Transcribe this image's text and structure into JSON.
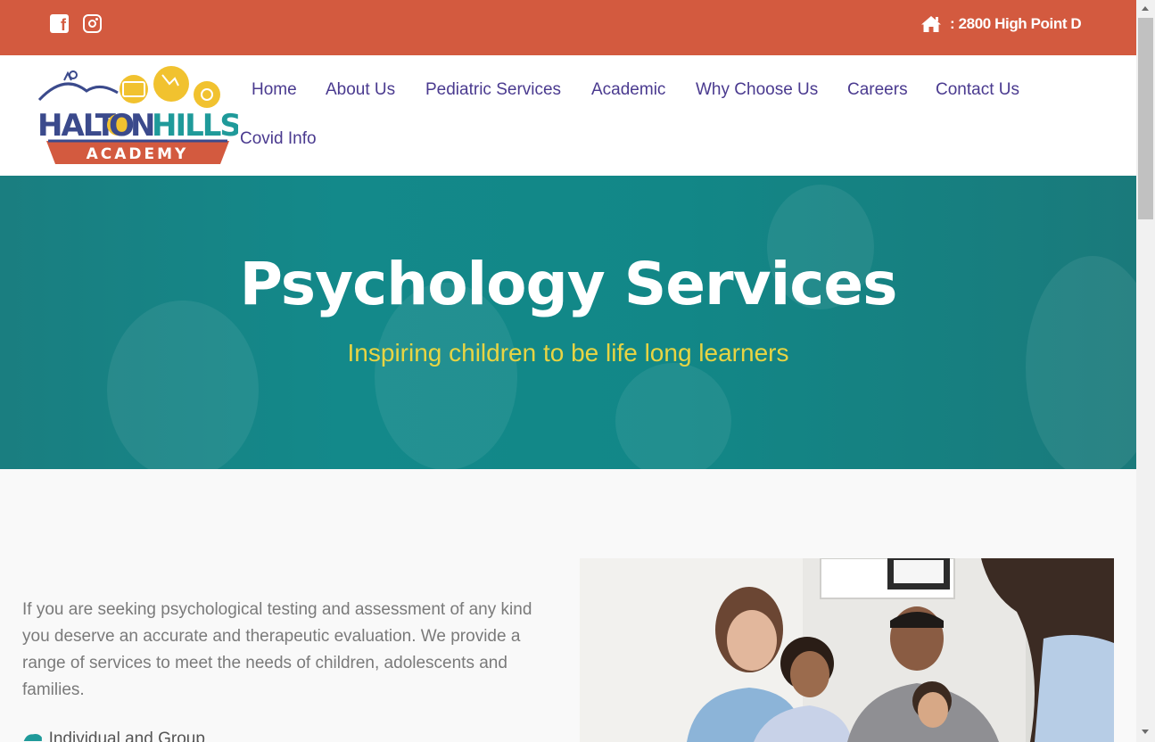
{
  "topbar": {
    "address_text": ": 2800 High Point D",
    "icons": [
      "facebook-icon",
      "instagram-icon",
      "home-icon"
    ],
    "bg_color": "#d35a3f"
  },
  "header": {
    "logo": {
      "line1": "HALTONHILLS",
      "line2": "ACADEMY"
    },
    "nav": [
      {
        "label": "Home"
      },
      {
        "label": "About Us"
      },
      {
        "label": "Pediatric Services"
      },
      {
        "label": "Academic"
      },
      {
        "label": "Why Choose Us"
      },
      {
        "label": "Careers"
      },
      {
        "label": "Contact Us"
      },
      {
        "label": "Covid Info"
      }
    ],
    "nav_color": "#4a3a8f"
  },
  "hero": {
    "title": "Psychology Services",
    "subtitle": "Inspiring children to be life long learners",
    "subtitle_color": "#e8d443"
  },
  "content": {
    "paragraph": "If you are seeking psychological testing and assessment of any kind you deserve an accurate and therapeutic evaluation. We provide a range of services to meet the needs of children, adolescents and families.",
    "bullet_label": "Individual and Group Therapy"
  }
}
